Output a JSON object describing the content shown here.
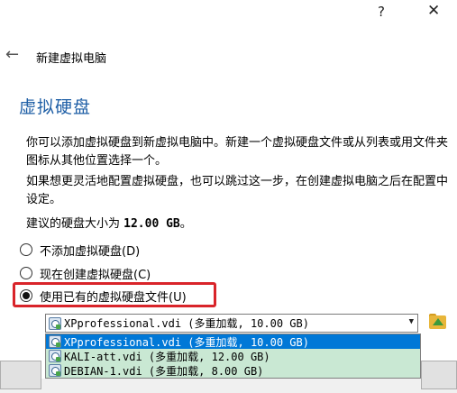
{
  "window": {
    "help_label": "?",
    "close_label": "✕",
    "back_icon": "back-arrow-icon",
    "title": "新建虚拟电脑"
  },
  "page": {
    "heading": "虚拟硬盘",
    "paragraph1": "你可以添加虚拟硬盘到新虚拟电脑中。新建一个虚拟硬盘文件或从列表或用文件夹图标从其他位置选择一个。",
    "paragraph2": "如果想更灵活地配置虚拟硬盘，也可以跳过这一步，在创建虚拟电脑之后在配置中设定。",
    "recommend_prefix": "建议的硬盘大小为 ",
    "recommend_value": "12.00 GB",
    "recommend_suffix": "。"
  },
  "options": {
    "none_label": "不添加虚拟硬盘(D)",
    "create_label": "现在创建虚拟硬盘(C)",
    "existing_label": "使用已有的虚拟硬盘文件(U)",
    "selected": "existing"
  },
  "disk_combo": {
    "selected_value": "XPprofessional.vdi (多重加载, 10.00 GB)",
    "items": [
      {
        "label": "XPprofessional.vdi (多重加载, 10.00 GB)",
        "selected": true
      },
      {
        "label": "KALI-att.vdi (多重加载, 12.00 GB)",
        "selected": false
      },
      {
        "label": "DEBIAN-1.vdi (多重加载, 8.00 GB)",
        "selected": false
      }
    ]
  },
  "colors": {
    "heading": "#1f5fa6",
    "highlight_border": "#d9242a",
    "selection": "#0078d7",
    "dropdown_bg": "#c9e8d3"
  }
}
